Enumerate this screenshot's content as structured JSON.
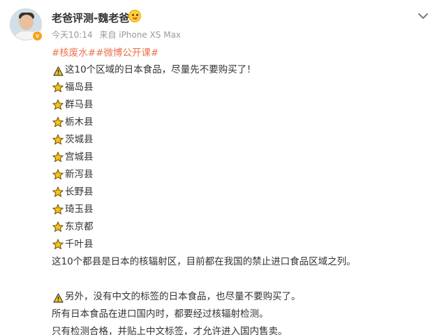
{
  "post": {
    "username": "老爸评测-魏老爸",
    "time": "今天10:14",
    "source": "来自 iPhone XS Max",
    "tags": "#核废水##微博公开课#",
    "lines": {
      "l0": "这10个区域的日本食品，尽量先不要购买了！",
      "l1": "福岛县",
      "l2": "群马县",
      "l3": "栃木县",
      "l4": "茨城县",
      "l5": "宫城县",
      "l6": "新泻县",
      "l7": "长野县",
      "l8": "琦玉县",
      "l9": "东京都",
      "l10": "千叶县",
      "l11": "这10个都县是日本的核辐射区，目前都在我国的禁止进口食品区域之列。",
      "l12": "另外，没有中文的标签的日本食品，也尽量不要购买了。",
      "l13": "所有日本食品在进口国内时，都要经过核辐射检测。",
      "l14": "只有检测合格，并贴上中文标签，才允许进入国内售卖。"
    }
  },
  "icons": {
    "avatar": "avatar-portrait",
    "verified": "verified-v-badge",
    "member_badge": "emoji-badge-icon",
    "menu": "chevron-down-icon",
    "warning": "warning-icon",
    "star": "star-icon"
  },
  "colors": {
    "tag": "#eb7350",
    "meta": "#999999",
    "text": "#333333",
    "star_fill": "#f5c518",
    "warning_fill": "#f5c518"
  }
}
